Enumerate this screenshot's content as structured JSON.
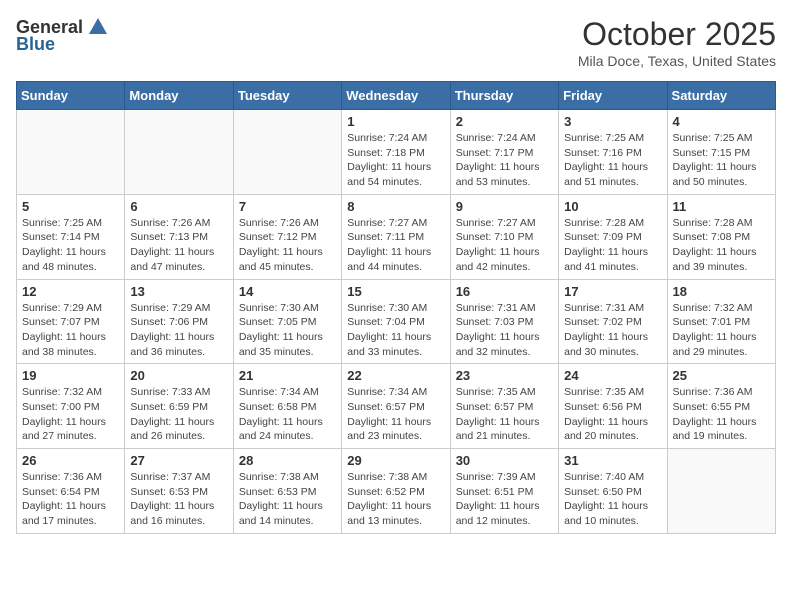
{
  "header": {
    "logo_general": "General",
    "logo_blue": "Blue",
    "month_title": "October 2025",
    "location": "Mila Doce, Texas, United States"
  },
  "days_of_week": [
    "Sunday",
    "Monday",
    "Tuesday",
    "Wednesday",
    "Thursday",
    "Friday",
    "Saturday"
  ],
  "weeks": [
    [
      {
        "day": "",
        "info": ""
      },
      {
        "day": "",
        "info": ""
      },
      {
        "day": "",
        "info": ""
      },
      {
        "day": "1",
        "info": "Sunrise: 7:24 AM\nSunset: 7:18 PM\nDaylight: 11 hours\nand 54 minutes."
      },
      {
        "day": "2",
        "info": "Sunrise: 7:24 AM\nSunset: 7:17 PM\nDaylight: 11 hours\nand 53 minutes."
      },
      {
        "day": "3",
        "info": "Sunrise: 7:25 AM\nSunset: 7:16 PM\nDaylight: 11 hours\nand 51 minutes."
      },
      {
        "day": "4",
        "info": "Sunrise: 7:25 AM\nSunset: 7:15 PM\nDaylight: 11 hours\nand 50 minutes."
      }
    ],
    [
      {
        "day": "5",
        "info": "Sunrise: 7:25 AM\nSunset: 7:14 PM\nDaylight: 11 hours\nand 48 minutes."
      },
      {
        "day": "6",
        "info": "Sunrise: 7:26 AM\nSunset: 7:13 PM\nDaylight: 11 hours\nand 47 minutes."
      },
      {
        "day": "7",
        "info": "Sunrise: 7:26 AM\nSunset: 7:12 PM\nDaylight: 11 hours\nand 45 minutes."
      },
      {
        "day": "8",
        "info": "Sunrise: 7:27 AM\nSunset: 7:11 PM\nDaylight: 11 hours\nand 44 minutes."
      },
      {
        "day": "9",
        "info": "Sunrise: 7:27 AM\nSunset: 7:10 PM\nDaylight: 11 hours\nand 42 minutes."
      },
      {
        "day": "10",
        "info": "Sunrise: 7:28 AM\nSunset: 7:09 PM\nDaylight: 11 hours\nand 41 minutes."
      },
      {
        "day": "11",
        "info": "Sunrise: 7:28 AM\nSunset: 7:08 PM\nDaylight: 11 hours\nand 39 minutes."
      }
    ],
    [
      {
        "day": "12",
        "info": "Sunrise: 7:29 AM\nSunset: 7:07 PM\nDaylight: 11 hours\nand 38 minutes."
      },
      {
        "day": "13",
        "info": "Sunrise: 7:29 AM\nSunset: 7:06 PM\nDaylight: 11 hours\nand 36 minutes."
      },
      {
        "day": "14",
        "info": "Sunrise: 7:30 AM\nSunset: 7:05 PM\nDaylight: 11 hours\nand 35 minutes."
      },
      {
        "day": "15",
        "info": "Sunrise: 7:30 AM\nSunset: 7:04 PM\nDaylight: 11 hours\nand 33 minutes."
      },
      {
        "day": "16",
        "info": "Sunrise: 7:31 AM\nSunset: 7:03 PM\nDaylight: 11 hours\nand 32 minutes."
      },
      {
        "day": "17",
        "info": "Sunrise: 7:31 AM\nSunset: 7:02 PM\nDaylight: 11 hours\nand 30 minutes."
      },
      {
        "day": "18",
        "info": "Sunrise: 7:32 AM\nSunset: 7:01 PM\nDaylight: 11 hours\nand 29 minutes."
      }
    ],
    [
      {
        "day": "19",
        "info": "Sunrise: 7:32 AM\nSunset: 7:00 PM\nDaylight: 11 hours\nand 27 minutes."
      },
      {
        "day": "20",
        "info": "Sunrise: 7:33 AM\nSunset: 6:59 PM\nDaylight: 11 hours\nand 26 minutes."
      },
      {
        "day": "21",
        "info": "Sunrise: 7:34 AM\nSunset: 6:58 PM\nDaylight: 11 hours\nand 24 minutes."
      },
      {
        "day": "22",
        "info": "Sunrise: 7:34 AM\nSunset: 6:57 PM\nDaylight: 11 hours\nand 23 minutes."
      },
      {
        "day": "23",
        "info": "Sunrise: 7:35 AM\nSunset: 6:57 PM\nDaylight: 11 hours\nand 21 minutes."
      },
      {
        "day": "24",
        "info": "Sunrise: 7:35 AM\nSunset: 6:56 PM\nDaylight: 11 hours\nand 20 minutes."
      },
      {
        "day": "25",
        "info": "Sunrise: 7:36 AM\nSunset: 6:55 PM\nDaylight: 11 hours\nand 19 minutes."
      }
    ],
    [
      {
        "day": "26",
        "info": "Sunrise: 7:36 AM\nSunset: 6:54 PM\nDaylight: 11 hours\nand 17 minutes."
      },
      {
        "day": "27",
        "info": "Sunrise: 7:37 AM\nSunset: 6:53 PM\nDaylight: 11 hours\nand 16 minutes."
      },
      {
        "day": "28",
        "info": "Sunrise: 7:38 AM\nSunset: 6:53 PM\nDaylight: 11 hours\nand 14 minutes."
      },
      {
        "day": "29",
        "info": "Sunrise: 7:38 AM\nSunset: 6:52 PM\nDaylight: 11 hours\nand 13 minutes."
      },
      {
        "day": "30",
        "info": "Sunrise: 7:39 AM\nSunset: 6:51 PM\nDaylight: 11 hours\nand 12 minutes."
      },
      {
        "day": "31",
        "info": "Sunrise: 7:40 AM\nSunset: 6:50 PM\nDaylight: 11 hours\nand 10 minutes."
      },
      {
        "day": "",
        "info": ""
      }
    ]
  ]
}
